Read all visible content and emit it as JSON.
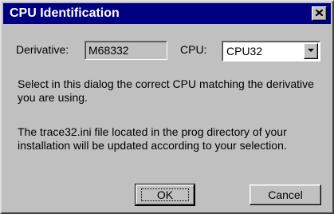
{
  "dialog": {
    "title": "CPU Identification",
    "close_icon": "close-icon"
  },
  "derivative": {
    "label": "Derivative:",
    "value": "M68332"
  },
  "cpu": {
    "label": "CPU:",
    "selected": "CPU32",
    "dropdown_icon": "chevron-down-icon"
  },
  "message": {
    "line1": "Select in this dialog the correct CPU matching the derivative you are using.",
    "line2": "The trace32.ini file located in the prog directory of your installation will be updated according to your selection."
  },
  "buttons": {
    "ok": "OK",
    "cancel": "Cancel"
  },
  "colors": {
    "titlebar": "#000080",
    "face": "#c0c0c0"
  }
}
